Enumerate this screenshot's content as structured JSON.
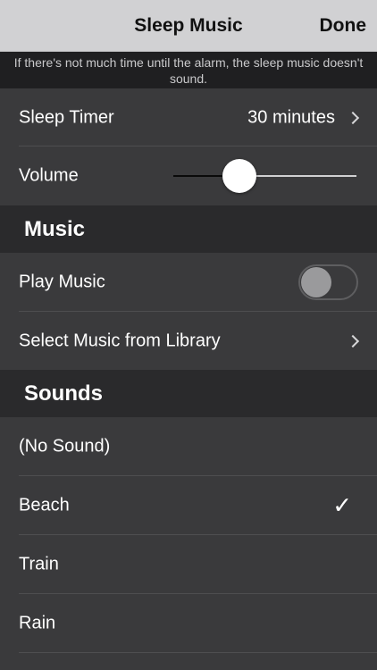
{
  "navbar": {
    "title": "Sleep Music",
    "done_label": "Done"
  },
  "notice": "If there's not much time until the alarm, the sleep music doesn't sound.",
  "sleep_timer": {
    "label": "Sleep Timer",
    "value": "30 minutes"
  },
  "volume": {
    "label": "Volume",
    "level_fraction": 0.33
  },
  "music_section": {
    "header": "Music",
    "play_music_label": "Play Music",
    "play_music_on": false,
    "select_library_label": "Select Music from Library"
  },
  "sounds_section": {
    "header": "Sounds",
    "items": [
      {
        "label": "(No Sound)",
        "selected": false
      },
      {
        "label": "Beach",
        "selected": true
      },
      {
        "label": "Train",
        "selected": false
      },
      {
        "label": "Rain",
        "selected": false
      }
    ],
    "check_glyph": "✓"
  },
  "colors": {
    "navbar_bg": "#d1d1d3",
    "row_bg": "#3a3a3c",
    "section_bg": "#2a2a2c",
    "page_bg": "#1c1c1e"
  }
}
